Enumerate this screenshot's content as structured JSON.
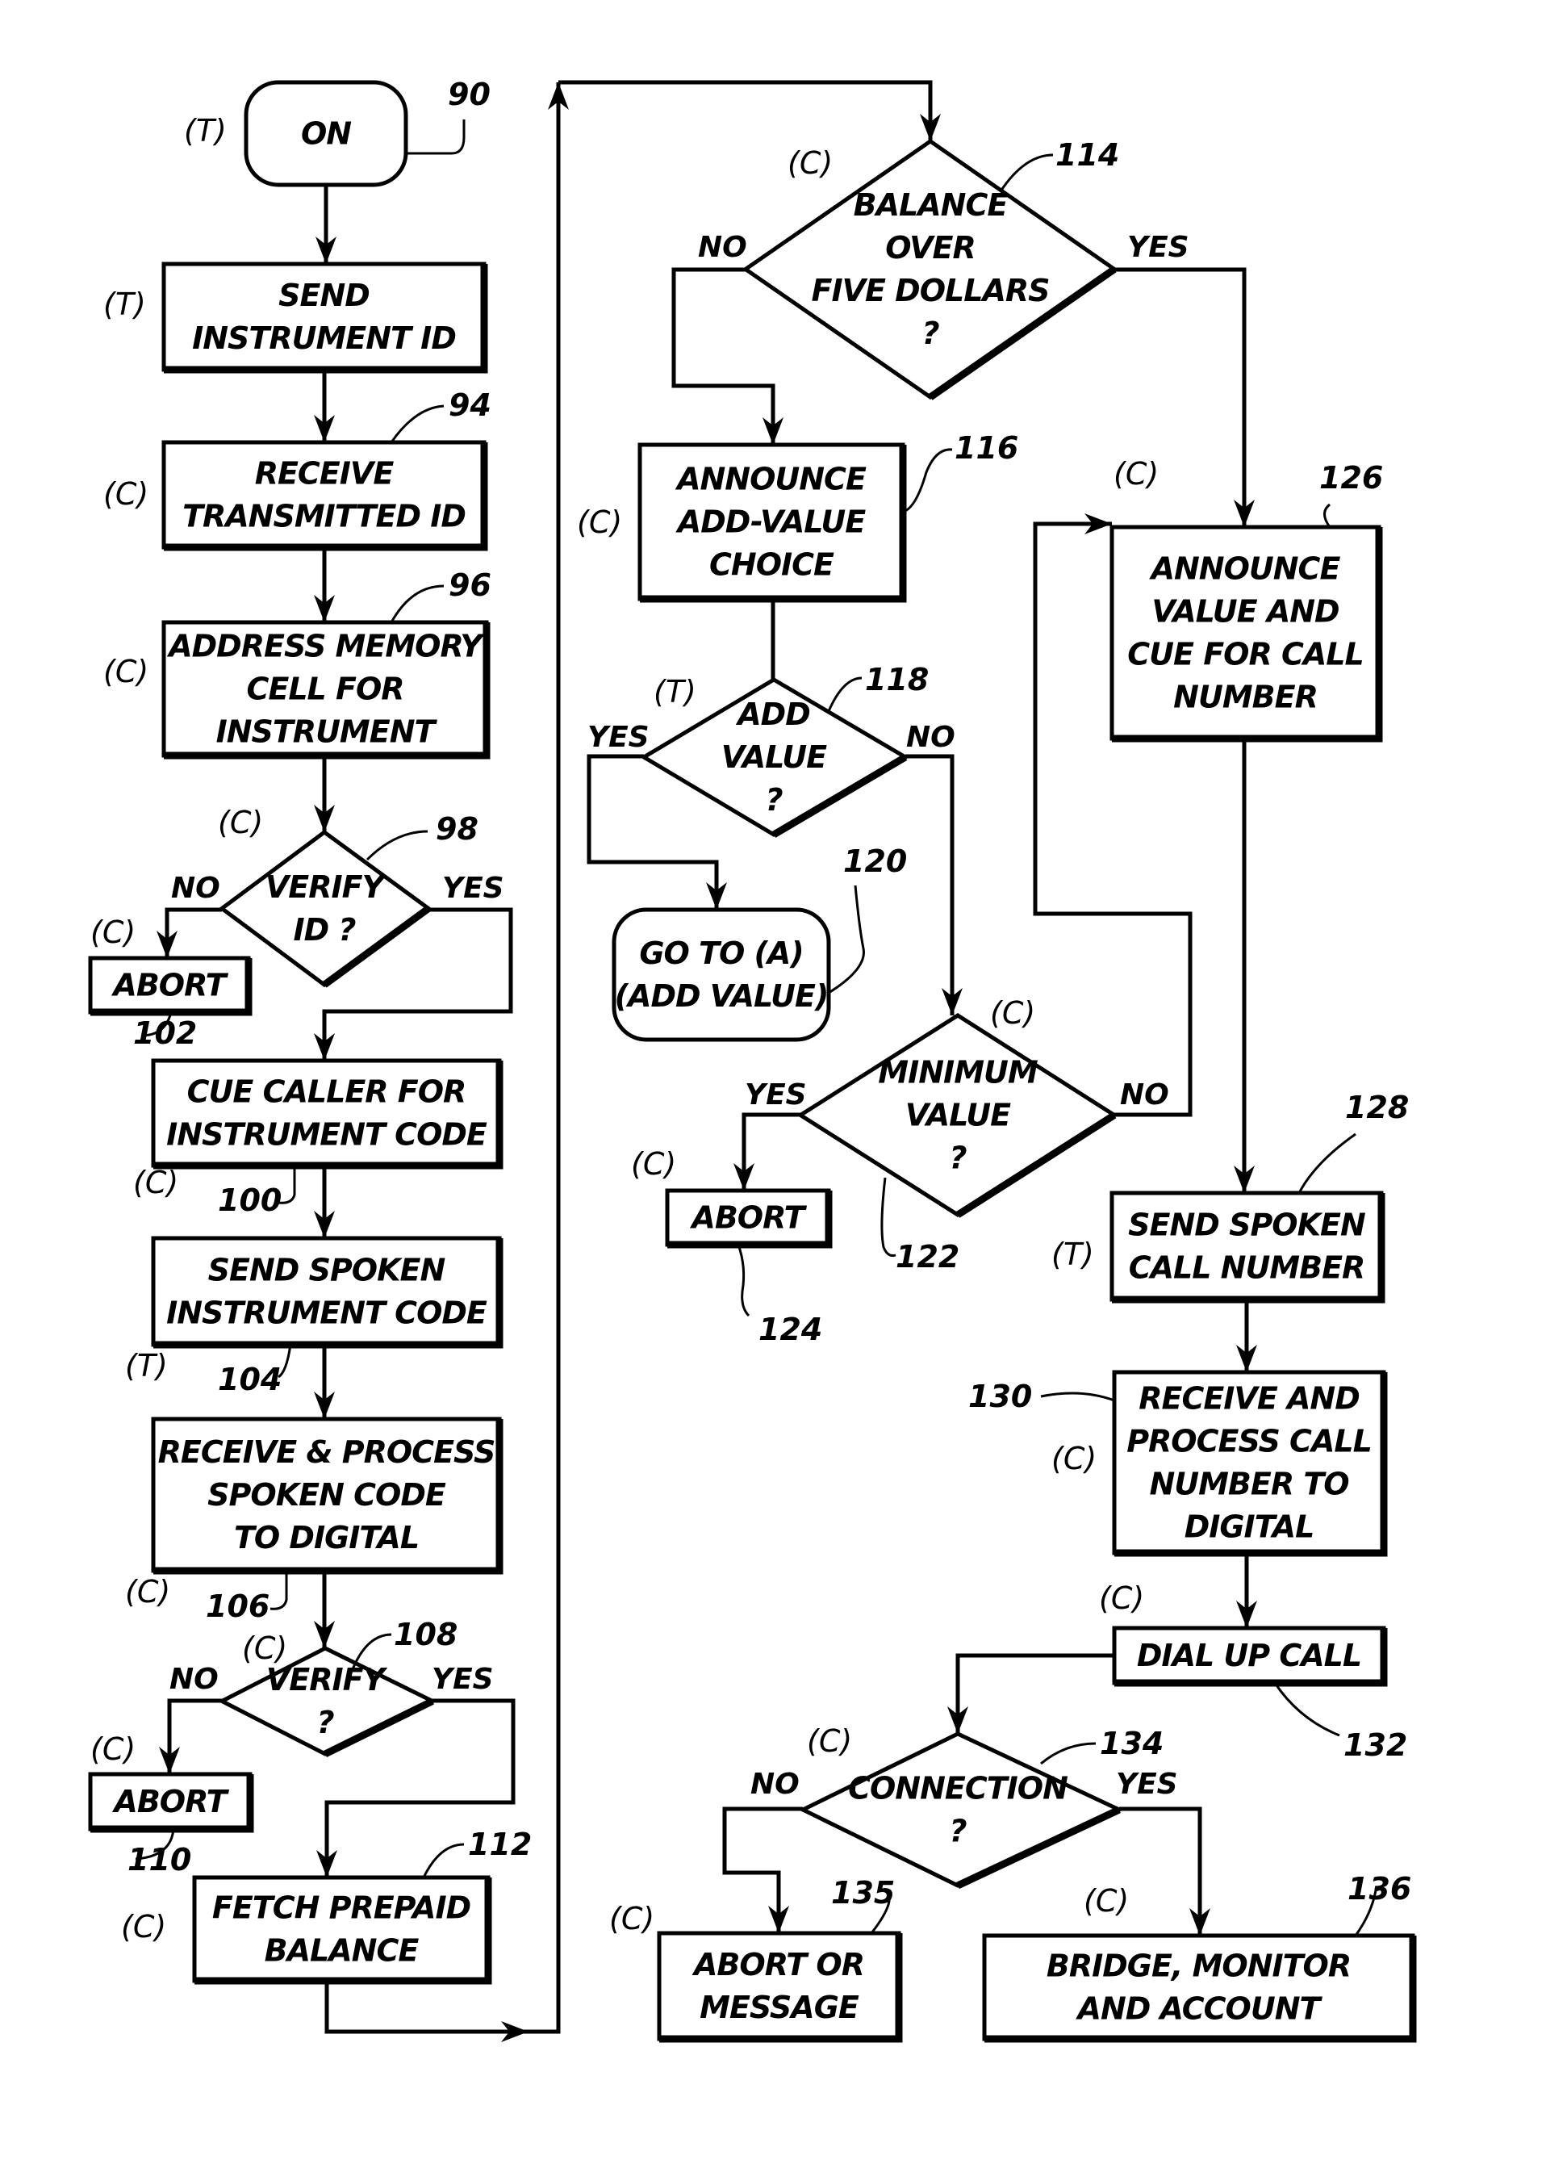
{
  "figure": {
    "type": "flowchart",
    "subject": "prepaid calling instrument call flow"
  },
  "nodes": {
    "on": {
      "ref": "90",
      "actor": "(T)",
      "shape": "terminal",
      "lines": [
        "ON"
      ]
    },
    "send_id": {
      "ref": "",
      "actor": "(T)",
      "shape": "process",
      "lines": [
        "SEND",
        "INSTRUMENT ID"
      ]
    },
    "receive_id": {
      "ref": "94",
      "actor": "(C)",
      "shape": "process",
      "lines": [
        "RECEIVE",
        "TRANSMITTED ID"
      ]
    },
    "address_mem": {
      "ref": "96",
      "actor": "(C)",
      "shape": "process",
      "lines": [
        "ADDRESS MEMORY",
        "CELL FOR",
        "INSTRUMENT"
      ]
    },
    "verify_id": {
      "ref": "98",
      "actor": "(C)",
      "shape": "decision",
      "lines": [
        "VERIFY",
        "ID ?"
      ],
      "no": "NO",
      "yes": "YES"
    },
    "abort_102": {
      "ref": "102",
      "actor": "(C)",
      "shape": "process",
      "lines": [
        "ABORT"
      ]
    },
    "cue_caller": {
      "ref": "100",
      "actor": "(C)",
      "shape": "process",
      "lines": [
        "CUE CALLER FOR",
        "INSTRUMENT CODE"
      ]
    },
    "send_code": {
      "ref": "104",
      "actor": "(T)",
      "shape": "process",
      "lines": [
        "SEND SPOKEN",
        "INSTRUMENT CODE"
      ]
    },
    "process_code": {
      "ref": "106",
      "actor": "(C)",
      "shape": "process",
      "lines": [
        "RECEIVE & PROCESS",
        "SPOKEN CODE",
        "TO DIGITAL"
      ]
    },
    "verify_code": {
      "ref": "108",
      "actor": "(C)",
      "shape": "decision",
      "lines": [
        "VERIFY",
        "?"
      ],
      "no": "NO",
      "yes": "YES"
    },
    "abort_110": {
      "ref": "110",
      "actor": "(C)",
      "shape": "process",
      "lines": [
        "ABORT"
      ]
    },
    "fetch_balance": {
      "ref": "112",
      "actor": "(C)",
      "shape": "process",
      "lines": [
        "FETCH PREPAID",
        "BALANCE"
      ]
    },
    "balance_check": {
      "ref": "114",
      "actor": "(C)",
      "shape": "decision",
      "lines": [
        "BALANCE",
        "OVER",
        "FIVE DOLLARS",
        "?"
      ],
      "no": "NO",
      "yes": "YES"
    },
    "announce_add": {
      "ref": "116",
      "actor": "(C)",
      "shape": "process",
      "lines": [
        "ANNOUNCE",
        "ADD-VALUE",
        "CHOICE"
      ]
    },
    "add_value": {
      "ref": "118",
      "actor": "(T)",
      "shape": "decision",
      "lines": [
        "ADD",
        "VALUE",
        "?"
      ],
      "no": "NO",
      "yes": "YES"
    },
    "goto_a": {
      "ref": "120",
      "actor": "",
      "shape": "terminal",
      "lines": [
        "GO TO (A)",
        "(ADD VALUE)"
      ]
    },
    "min_value": {
      "ref": "122",
      "actor": "(C)",
      "shape": "decision",
      "lines": [
        "MINIMUM",
        "VALUE",
        "?"
      ],
      "no": "NO",
      "yes": "YES"
    },
    "abort_124": {
      "ref": "124",
      "actor": "(C)",
      "shape": "process",
      "lines": [
        "ABORT"
      ]
    },
    "announce_val": {
      "ref": "126",
      "actor": "(C)",
      "shape": "process",
      "lines": [
        "ANNOUNCE",
        "VALUE AND",
        "CUE FOR CALL",
        "NUMBER"
      ]
    },
    "send_call": {
      "ref": "128",
      "actor": "(T)",
      "shape": "process",
      "lines": [
        "SEND SPOKEN",
        "CALL NUMBER"
      ]
    },
    "process_call": {
      "ref": "130",
      "actor": "(C)",
      "shape": "process",
      "lines": [
        "RECEIVE AND",
        "PROCESS CALL",
        "NUMBER TO",
        "DIGITAL"
      ]
    },
    "dial_up": {
      "ref": "132",
      "actor": "(C)",
      "shape": "process",
      "lines": [
        "DIAL UP CALL"
      ]
    },
    "connection": {
      "ref": "134",
      "actor": "(C)",
      "shape": "decision",
      "lines": [
        "CONNECTION",
        "?"
      ],
      "no": "NO",
      "yes": "YES"
    },
    "abort_msg": {
      "ref": "135",
      "actor": "(C)",
      "shape": "process",
      "lines": [
        "ABORT OR",
        "MESSAGE"
      ]
    },
    "bridge": {
      "ref": "136",
      "actor": "(C)",
      "shape": "process",
      "lines": [
        "BRIDGE, MONITOR",
        "AND ACCOUNT"
      ]
    }
  },
  "edges": [
    {
      "from": "on",
      "to": "send_id",
      "label": ""
    },
    {
      "from": "send_id",
      "to": "receive_id",
      "label": ""
    },
    {
      "from": "receive_id",
      "to": "address_mem",
      "label": ""
    },
    {
      "from": "address_mem",
      "to": "verify_id",
      "label": ""
    },
    {
      "from": "verify_id",
      "to": "abort_102",
      "label": "NO"
    },
    {
      "from": "verify_id",
      "to": "cue_caller",
      "label": "YES"
    },
    {
      "from": "cue_caller",
      "to": "send_code",
      "label": ""
    },
    {
      "from": "send_code",
      "to": "process_code",
      "label": ""
    },
    {
      "from": "process_code",
      "to": "verify_code",
      "label": ""
    },
    {
      "from": "verify_code",
      "to": "abort_110",
      "label": "NO"
    },
    {
      "from": "verify_code",
      "to": "fetch_balance",
      "label": "YES"
    },
    {
      "from": "fetch_balance",
      "to": "balance_check",
      "label": ""
    },
    {
      "from": "balance_check",
      "to": "announce_add",
      "label": "NO"
    },
    {
      "from": "balance_check",
      "to": "announce_val",
      "label": "YES"
    },
    {
      "from": "announce_add",
      "to": "add_value",
      "label": ""
    },
    {
      "from": "add_value",
      "to": "goto_a",
      "label": "YES"
    },
    {
      "from": "add_value",
      "to": "min_value",
      "label": "NO"
    },
    {
      "from": "min_value",
      "to": "abort_124",
      "label": "YES"
    },
    {
      "from": "min_value",
      "to": "announce_val",
      "label": "NO"
    },
    {
      "from": "announce_val",
      "to": "send_call",
      "label": ""
    },
    {
      "from": "send_call",
      "to": "process_call",
      "label": ""
    },
    {
      "from": "process_call",
      "to": "dial_up",
      "label": ""
    },
    {
      "from": "dial_up",
      "to": "connection",
      "label": ""
    },
    {
      "from": "connection",
      "to": "abort_msg",
      "label": "NO"
    },
    {
      "from": "connection",
      "to": "bridge",
      "label": "YES"
    }
  ]
}
